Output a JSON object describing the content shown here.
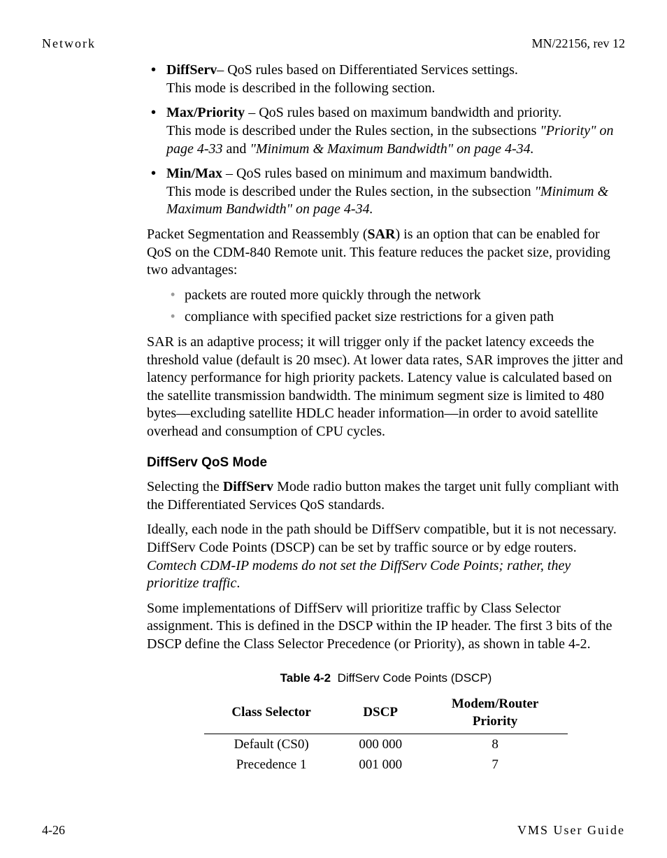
{
  "header": {
    "left": "Network",
    "right": "MN/22156, rev 12"
  },
  "bullets": [
    {
      "term": "DiffServ",
      "sep": "– ",
      "tail": "QoS rules based on Differentiated Services settings.",
      "line2": "This mode is described in the following section."
    },
    {
      "term": "Max/Priority",
      "sep": " – ",
      "tail": "QoS rules based on maximum bandwidth and priority.",
      "line2_pre": "This mode is described under the Rules section, in the subsections ",
      "ref1": "\"Priority\" on page 4-33",
      "mid": " and ",
      "ref2": "\"Minimum & Maximum Bandwidth\" on page 4-34."
    },
    {
      "term": "Min/Max",
      "sep": " – ",
      "tail": "QoS rules based on minimum and maximum bandwidth.",
      "line2_pre": "This mode is described under the Rules section, in the subsection ",
      "ref1": "\"Minimum & Maximum Bandwidth\" on page 4-34."
    }
  ],
  "sar_para_pre": "Packet Segmentation and Reassembly (",
  "sar_bold": "SAR",
  "sar_para_post": ") is an option that can be enabled for QoS on the CDM-840 Remote unit. This feature reduces the packet size, providing two advantages:",
  "sub_bullets": [
    "packets are routed more quickly through the network",
    "compliance with specified packet size restrictions for a given path"
  ],
  "sar_adapt": "SAR is an adaptive process; it will trigger only if the packet latency exceeds the threshold value (default is 20 msec). At lower data rates, SAR improves the jitter and latency performance for high priority packets. Latency value is calculated based on the satellite transmission bandwidth. The minimum segment size is limited to 480 bytes—excluding satellite HDLC header information—in order to avoid satellite overhead and consumption of CPU cycles.",
  "h3": "DiffServ QoS Mode",
  "ds_p1_pre": "Selecting the ",
  "ds_p1_bold": "DiffServ",
  "ds_p1_post": " Mode radio button makes the target unit fully compliant with the Differentiated Services QoS standards.",
  "ds_p2_pre": "Ideally, each node in the path should be DiffServ compatible, but it is not necessary. DiffServ Code Points (DSCP) can be set by traffic source or by edge routers. ",
  "ds_p2_italic": "Comtech CDM-IP modems do not set the DiffServ Code Points; rather, they prioritize traffic",
  "ds_p2_post": ".",
  "ds_p3": "Some implementations of DiffServ will prioritize traffic by Class Selector assignment. This is defined in the DSCP within the IP header. The first 3 bits of the DSCP define the Class Selector Precedence (or Priority), as shown in table 4-2.",
  "table": {
    "caption_label": "Table 4-2",
    "caption_text": "DiffServ Code Points (DSCP)",
    "headers": {
      "c1": "Class Selector",
      "c2": "DSCP",
      "c3a": "Modem/Router",
      "c3b": "Priority"
    },
    "rows": [
      {
        "c1": "Default (CS0)",
        "c2": "000 000",
        "c3": "8"
      },
      {
        "c1": "Precedence 1",
        "c2": "001 000",
        "c3": "7"
      }
    ]
  },
  "footer": {
    "left": "4-26",
    "right": "VMS User Guide"
  }
}
